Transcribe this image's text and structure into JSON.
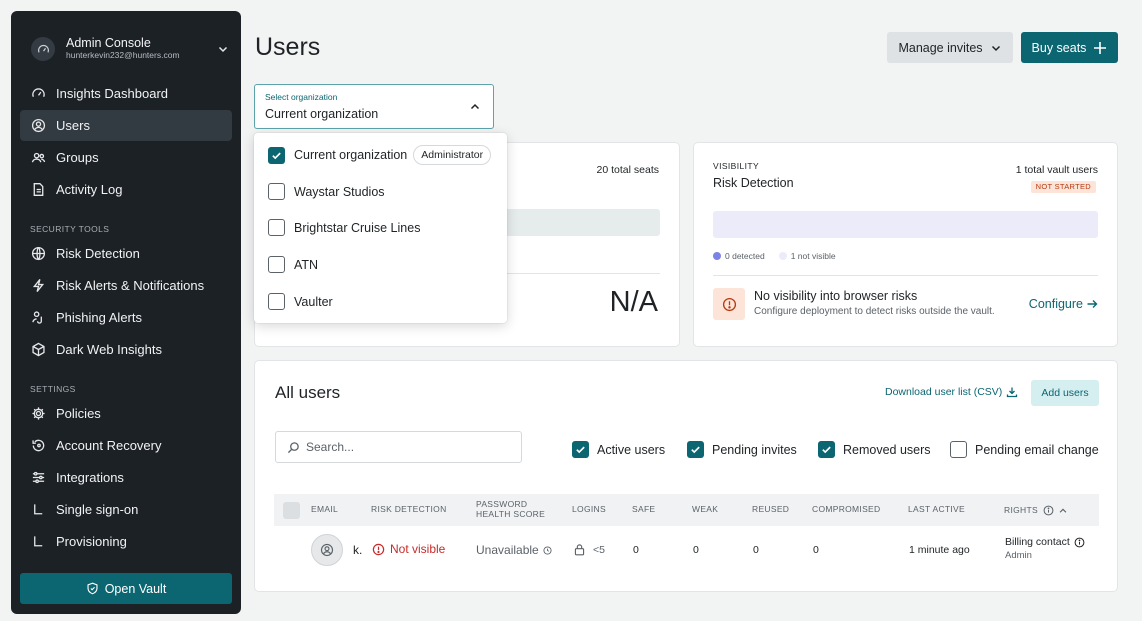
{
  "sidebar": {
    "account_title": "Admin Console",
    "account_email": "hunterkevin232@hunters.com",
    "items": [
      {
        "label": "Insights Dashboard"
      },
      {
        "label": "Users"
      },
      {
        "label": "Groups"
      },
      {
        "label": "Activity Log"
      }
    ],
    "security_label": "SECURITY TOOLS",
    "security_items": [
      {
        "label": "Risk Detection"
      },
      {
        "label": "Risk Alerts & Notifications"
      },
      {
        "label": "Phishing Alerts"
      },
      {
        "label": "Dark Web Insights"
      }
    ],
    "settings_label": "SETTINGS",
    "settings_items": [
      {
        "label": "Policies"
      },
      {
        "label": "Account Recovery"
      },
      {
        "label": "Integrations"
      },
      {
        "label": "Single sign-on"
      },
      {
        "label": "Provisioning"
      }
    ],
    "open_vault": "Open Vault"
  },
  "header": {
    "title": "Users",
    "manage_invites": "Manage invites",
    "buy_seats": "Buy seats"
  },
  "org_select": {
    "label": "Select organization",
    "value": "Current organization",
    "options": [
      {
        "label": "Current organization",
        "checked": true,
        "badge": "Administrator"
      },
      {
        "label": "Waystar Studios",
        "checked": false
      },
      {
        "label": "Brightstar Cruise Lines",
        "checked": false
      },
      {
        "label": "ATN",
        "checked": false
      },
      {
        "label": "Vaulter",
        "checked": false
      }
    ]
  },
  "seats_card": {
    "total_seats": "20 total seats",
    "metric": "N/A"
  },
  "visibility_card": {
    "section": "VISIBILITY",
    "title": "Risk Detection",
    "total": "1 total vault users",
    "badge": "NOT STARTED",
    "legend_detected": "0 detected",
    "legend_not_visible": "1 not visible",
    "warn_title": "No visibility into browser risks",
    "warn_sub": "Configure deployment to detect risks outside the vault.",
    "configure": "Configure",
    "detected_color": "#7b83e6",
    "not_visible_color": "#ecebfa"
  },
  "all_users": {
    "title": "All users",
    "download": "Download user list (CSV)",
    "add_users": "Add users",
    "search_placeholder": "Search...",
    "filters": [
      {
        "label": "Active users",
        "checked": true
      },
      {
        "label": "Pending invites",
        "checked": true
      },
      {
        "label": "Removed users",
        "checked": true
      },
      {
        "label": "Pending email change",
        "checked": false
      }
    ],
    "columns": {
      "email": "EMAIL",
      "risk": "RISK DETECTION",
      "pw1": "PASSWORD",
      "pw2": "HEALTH SCORE",
      "logins": "LOGINS",
      "safe": "SAFE",
      "weak": "WEAK",
      "reused": "REUSED",
      "compromised": "COMPROMISED",
      "last_active": "LAST ACTIVE",
      "rights": "RIGHTS"
    },
    "rows": [
      {
        "email": "k.",
        "risk": "Not visible",
        "health": "Unavailable",
        "logins": "<5",
        "safe": "0",
        "weak": "0",
        "reused": "0",
        "compromised": "0",
        "last_active": "1 minute ago",
        "rights": "Billing contact",
        "role": "Admin"
      }
    ]
  },
  "colors": {
    "accent": "#0b6672",
    "sidebar_bg": "#1c2126",
    "danger": "#c62b2b"
  }
}
